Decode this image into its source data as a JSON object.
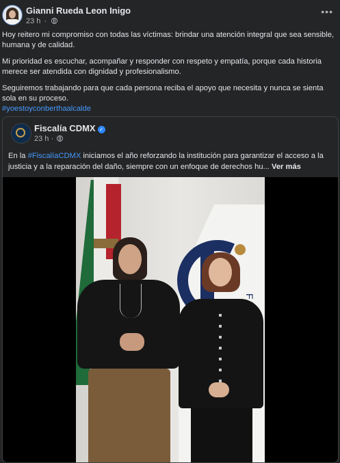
{
  "post": {
    "author": "Gianni Rueda Leon Inigo",
    "time": "23 h",
    "separator": "·",
    "more_label": "•••",
    "paragraphs": [
      "Hoy reitero mi compromiso con todas las víctimas: brindar una atención integral que sea sensible, humana y de calidad.",
      "Mi prioridad es escuchar, acompañar y responder con respeto y empatía, porque cada historia merece ser atendida con dignidad y profesionalismo.",
      "Seguiremos trabajando para que cada persona reciba el apoyo que necesita y nunca se sienta sola en su proceso."
    ],
    "hashtag": "#yoestoyconberthaalcalde"
  },
  "shared": {
    "page_name": "Fiscalía CDMX",
    "time": "23 h",
    "separator": "·",
    "text_prefix": "En la ",
    "text_hashtag": "#FiscalíaCDMX",
    "text_rest": " iniciamos el año reforzando la institución para garantizar el acceso a la justicia y a la reparación del daño, siempre con un enfoque de derechos hu...",
    "see_more": "Ver más",
    "banner_text": "FISCALÍA"
  },
  "colors": {
    "background": "#242526",
    "text": "#e4e6eb",
    "muted": "#b0b3b8",
    "link": "#4599ff",
    "verified": "#2d88ff"
  },
  "icons": [
    "avatar",
    "globe-icon",
    "more-icon",
    "verified-icon"
  ]
}
